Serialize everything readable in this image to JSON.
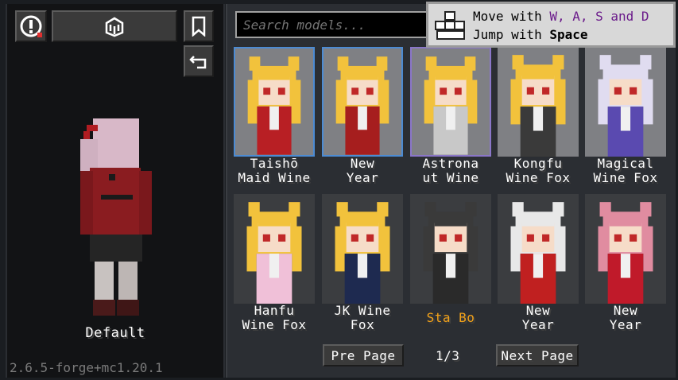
{
  "left": {
    "info_icon": "alert-icon",
    "skin_icon": "character-icon",
    "bookmark_icon": "bookmark-icon",
    "reset_icon": "undo-icon",
    "default_label": "Default",
    "version": "2.6.5-forge+mc1.20.1"
  },
  "search": {
    "placeholder": "Search models..."
  },
  "tooltip": {
    "line1_prefix": "Move with ",
    "line1_keys": "W, A, S and D",
    "line2_prefix": "Jump with ",
    "line2_key": "Space",
    "icon": "keyboard-icon"
  },
  "models": [
    {
      "name_line1": "Taishō",
      "name_line2": "Maid Wine",
      "hair": "#f2c23c",
      "outfit": "#b81f24",
      "border": "blue"
    },
    {
      "name_line1": "New",
      "name_line2": "Year",
      "hair": "#f2c23c",
      "outfit": "#a61e1e",
      "border": "blue"
    },
    {
      "name_line1": "Astrona",
      "name_line2": "ut Wine",
      "hair": "#f2c23c",
      "outfit": "#c8c8c8",
      "border": "purple"
    },
    {
      "name_line1": "Kongfu",
      "name_line2": "Wine Fox",
      "hair": "#f2c23c",
      "outfit": "#3a3a3a",
      "border": "none"
    },
    {
      "name_line1": "Magical",
      "name_line2": "Wine Fox",
      "hair": "#e0dcf0",
      "outfit": "#5a4ab0",
      "border": "none"
    },
    {
      "name_line1": "Hanfu",
      "name_line2": "Wine Fox",
      "hair": "#f2c23c",
      "outfit": "#f0c0d8",
      "border": "none"
    },
    {
      "name_line1": "JK Wine",
      "name_line2": "Fox",
      "hair": "#f2c23c",
      "outfit": "#1e2a50",
      "border": "none"
    },
    {
      "name_line1": "Sta Bo",
      "name_line2": "",
      "hair": "#3a3a3a",
      "outfit": "#2a2a2a",
      "border": "none"
    },
    {
      "name_line1": "New",
      "name_line2": "Year",
      "hair": "#e8e8e8",
      "outfit": "#c02020",
      "border": "none"
    },
    {
      "name_line1": "New",
      "name_line2": "Year",
      "hair": "#e08ca0",
      "outfit": "#c01a2a",
      "border": "none"
    }
  ],
  "pagination": {
    "pre_label": "Pre Page",
    "page": "1/3",
    "next_label": "Next Page"
  }
}
